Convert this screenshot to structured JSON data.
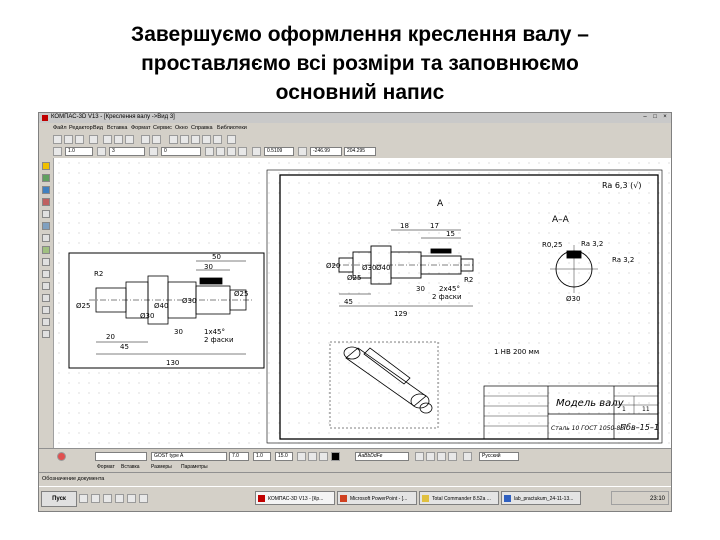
{
  "slide": {
    "title_lines": [
      "Завершуємо оформлення креслення валу –",
      "проставляємо всі розміри та заповнюємо",
      "основний напис"
    ]
  },
  "window": {
    "title": "КОМПАС-3D V13 - [Креслення валу ->Вид 3]"
  },
  "menu": [
    "Файл",
    "Редактор",
    "Вид",
    "Вставка",
    "Формат",
    "Сервис",
    "Окно",
    "Справка",
    "Библиотеки"
  ],
  "toolbar2": {
    "scale": "0.5109",
    "coord_x": "-246.99",
    "coord_y": "204.295"
  },
  "toolbar3": {
    "step": "1.0",
    "layer": "3",
    "view": "0"
  },
  "properties": {
    "font": "GOST type A",
    "size": "7.0",
    "narrowing": "1.0",
    "spacing": "15.0",
    "sample": "AaBbDdFe",
    "language": "Русский"
  },
  "tabs": [
    "Формат",
    "Вставка",
    "Размеры",
    "Параметры"
  ],
  "status": "Обозначение документа",
  "taskbar": {
    "start": "Пуск",
    "tasks": [
      "КОМПАС-3D V13 - [Кр...",
      "Microsoft PowerPoint - [...",
      "Total Commander 8.52a ...",
      "lab_practukum_24-11-13..."
    ],
    "clock": "23:10"
  },
  "drawing": {
    "left_view": {
      "dims": [
        "R2",
        "50",
        "30",
        "30",
        "1x45°",
        "Ø25",
        "Ø30",
        "Ø40",
        "Ø30",
        "Ø25",
        "2 фаски",
        "20",
        "45",
        "130"
      ]
    },
    "main_view": {
      "dims": [
        "А",
        "18",
        "17",
        "15",
        "Ø20",
        "Ø25",
        "Ø30",
        "Ø40",
        "R2",
        "30",
        "2x45°",
        "2 фаски",
        "45",
        "129"
      ]
    },
    "section": {
      "label": "А–А",
      "dims": [
        "R0,25",
        "Ra 3,2",
        "Ra 3,2",
        "Ø30"
      ]
    },
    "roughness": "Ra 6,3 (√)",
    "note": "1 НВ 200 мм",
    "title_block": {
      "name": "Модель валу",
      "material": "Сталь 10 ГОСТ 1050-88",
      "designation": "Пбв–15–1",
      "sheets": [
        "1",
        "11"
      ]
    }
  }
}
